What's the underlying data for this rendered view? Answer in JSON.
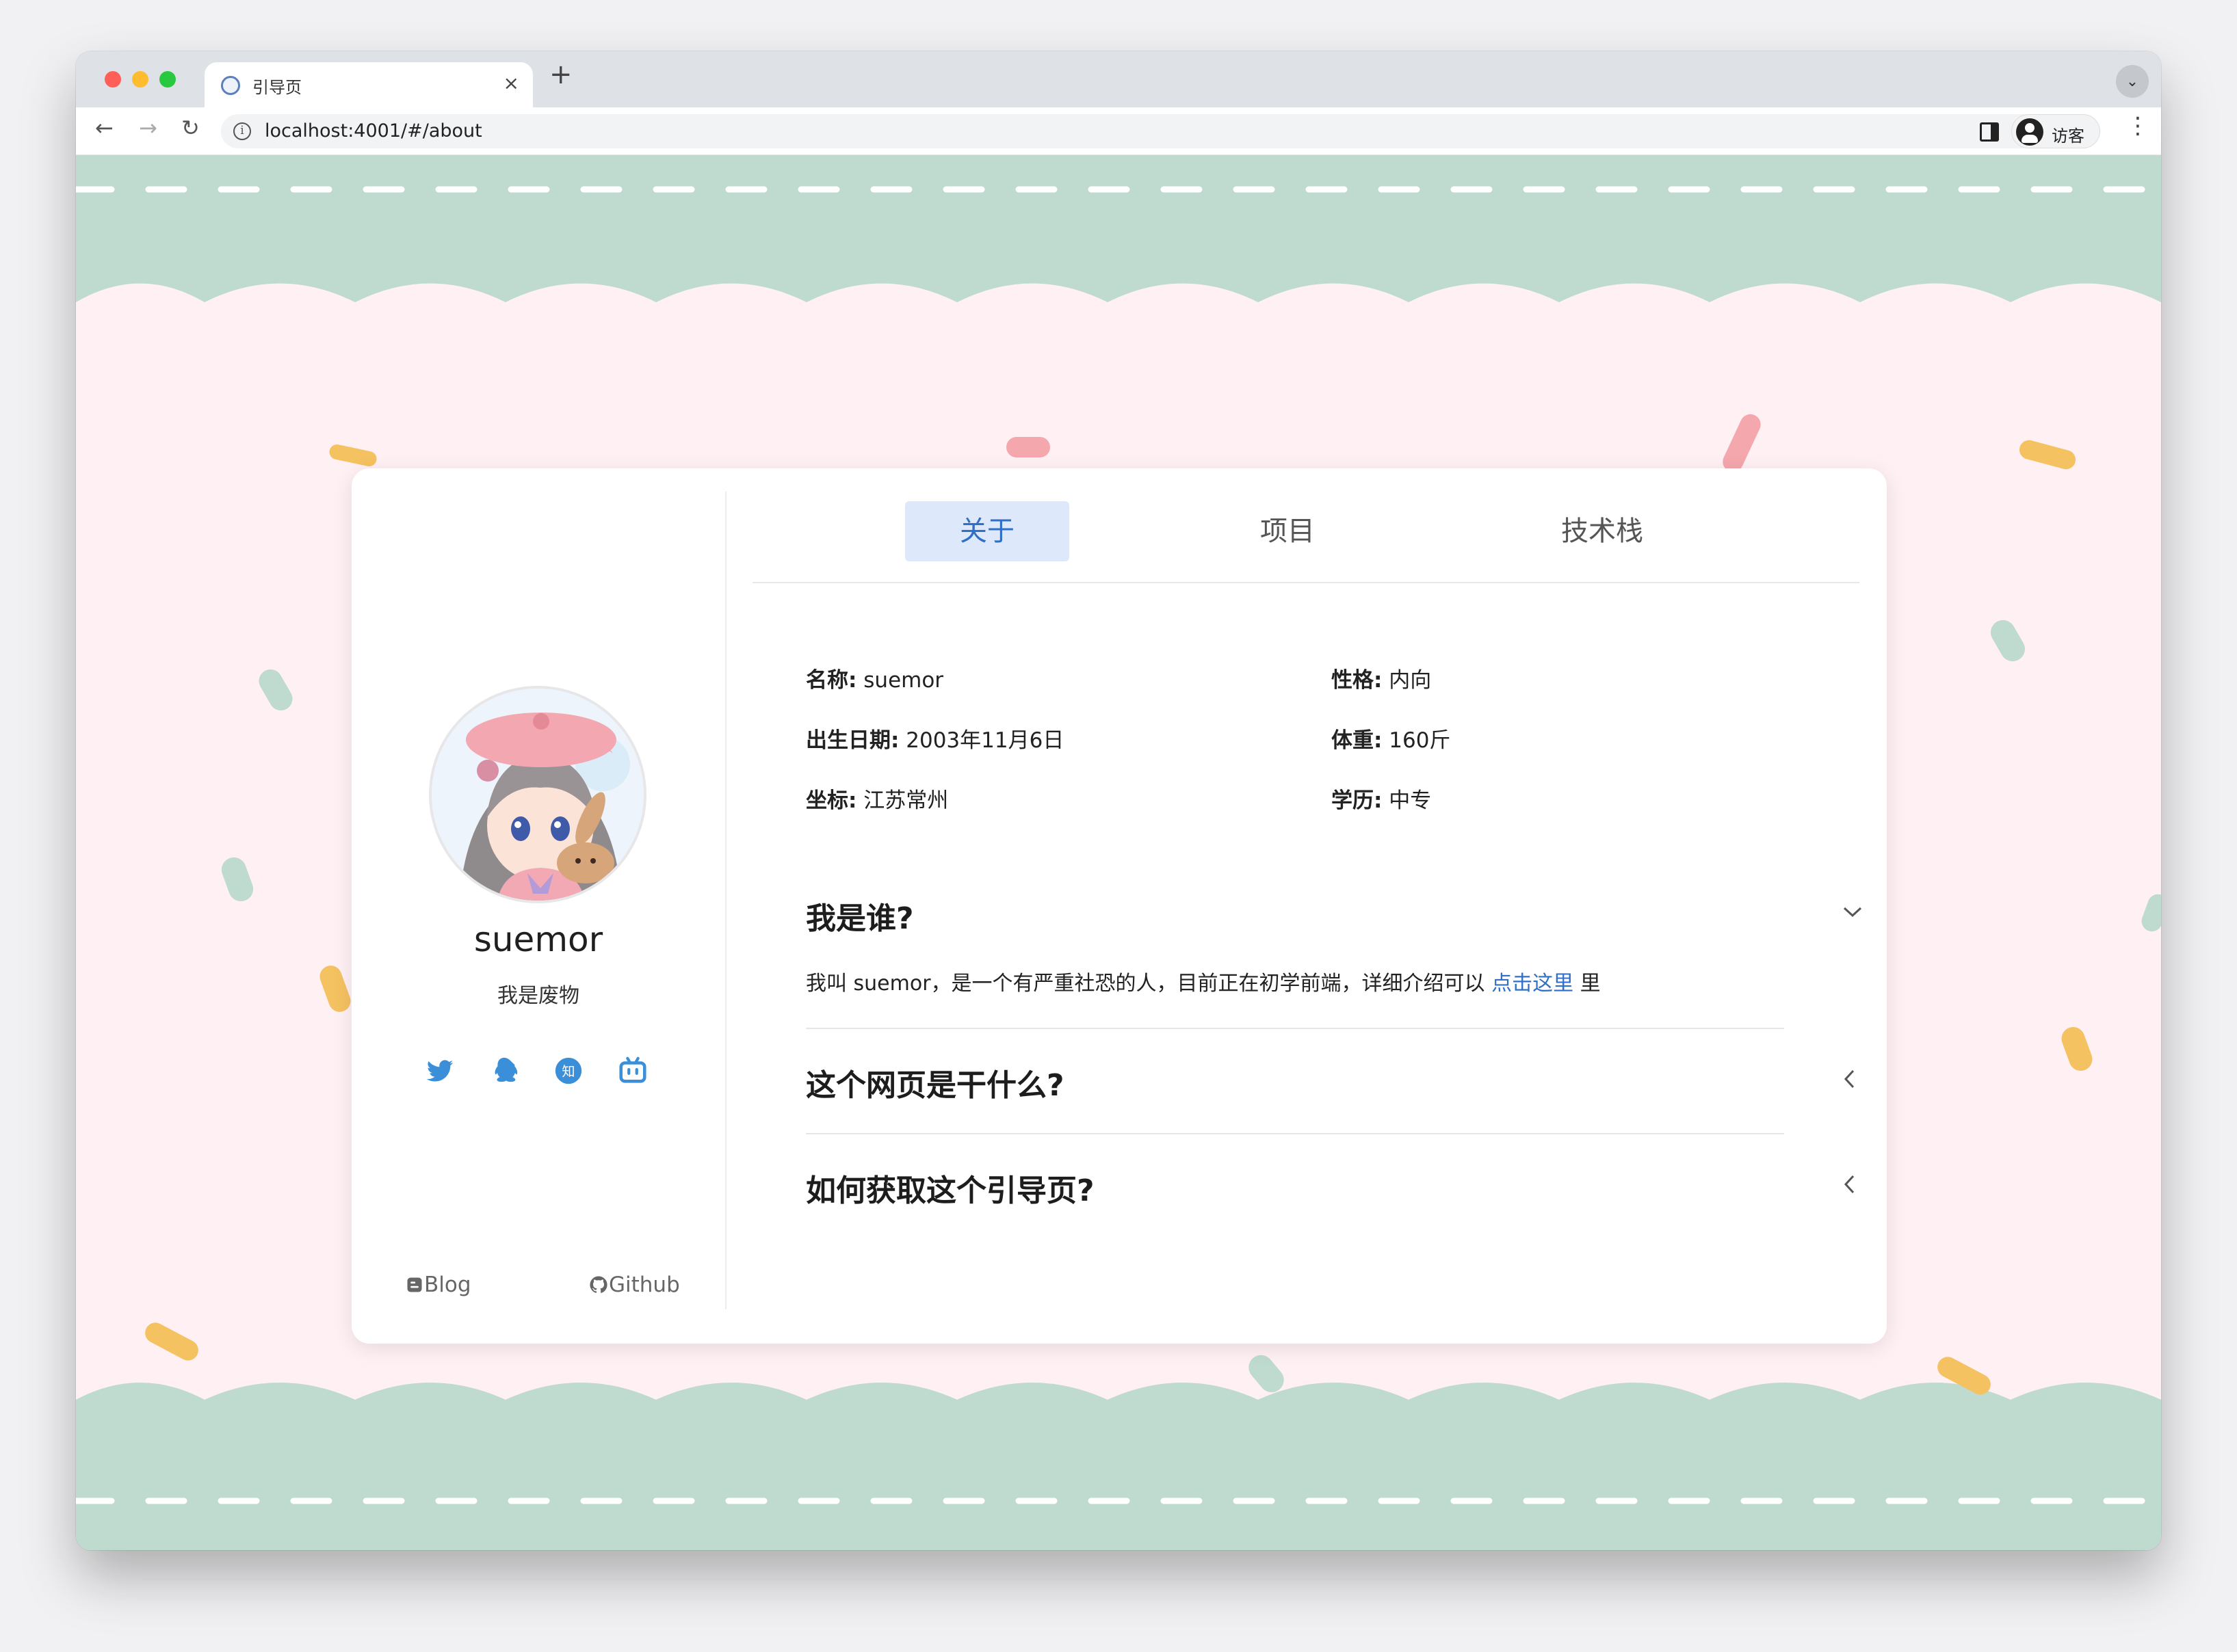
{
  "browser": {
    "tab_title": "引导页",
    "tab_close": "×",
    "new_tab": "+",
    "url": "localhost:4001/#/about",
    "profile_label": "访客",
    "nav_back": "←",
    "nav_forward": "→",
    "nav_reload": "↻",
    "menu": "⋮",
    "tab_search": "⌄"
  },
  "profile": {
    "name": "suemor",
    "bio": "我是废物",
    "social_icons": [
      "twitter-icon",
      "qq-icon",
      "zhihu-icon",
      "bilibili-icon"
    ],
    "footer_links": [
      {
        "label": "Blog",
        "icon": "blogger-icon"
      },
      {
        "label": "Github",
        "icon": "github-icon"
      }
    ]
  },
  "tabs": [
    {
      "label": "关于",
      "active": true
    },
    {
      "label": "项目",
      "active": false
    },
    {
      "label": "技术栈",
      "active": false
    }
  ],
  "info": [
    {
      "label": "名称:",
      "value": "suemor"
    },
    {
      "label": "性格:",
      "value": "内向"
    },
    {
      "label": "出生日期:",
      "value": "2003年11月6日"
    },
    {
      "label": "体重:",
      "value": "160斤"
    },
    {
      "label": "坐标:",
      "value": "江苏常州"
    },
    {
      "label": "学历:",
      "value": "中专"
    }
  ],
  "faq": [
    {
      "title": "我是谁?",
      "expanded": true,
      "body_prefix": "我叫 suemor，是一个有严重社恐的人，目前正在初学前端，详细介绍可以 ",
      "body_link": "点击这里",
      "body_suffix": " 里"
    },
    {
      "title": "这个网页是干什么?",
      "expanded": false
    },
    {
      "title": "如何获取这个引导页?",
      "expanded": false
    }
  ],
  "colors": {
    "accent": "#2f6fc7",
    "tab_active_bg": "#dde9fb",
    "page_bg": "#fff0f4",
    "band_green": "#bfdbd0"
  }
}
